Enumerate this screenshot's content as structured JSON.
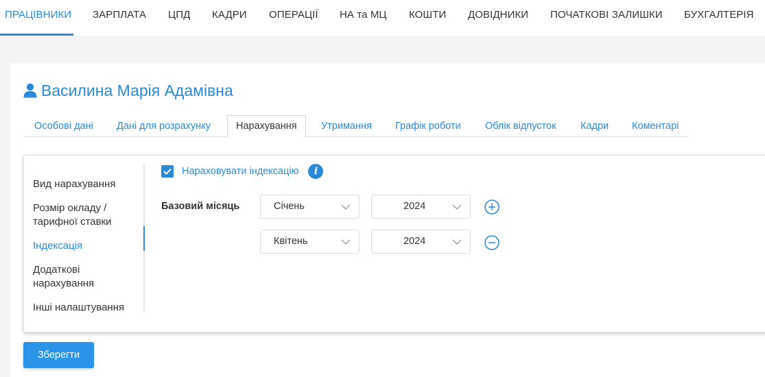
{
  "topnav": {
    "items": [
      "ПРАЦІВНИКИ",
      "ЗАРПЛАТА",
      "ЦПД",
      "КАДРИ",
      "ОПЕРАЦІЇ",
      "НА та МЦ",
      "КОШТИ",
      "ДОВІДНИКИ",
      "ПОЧАТКОВІ ЗАЛИШКИ",
      "БУХГАЛТЕРІЯ"
    ],
    "active_index": 0
  },
  "employee": {
    "icon": "user-icon",
    "name": "Василина Марія Адамівна"
  },
  "tabs": {
    "items": [
      "Особові дані",
      "Дані для розрахунку",
      "Нарахування",
      "Утримання",
      "Графік роботи",
      "Облік відпусток",
      "Кадри",
      "Коментарі"
    ],
    "active_index": 2
  },
  "sidemenu": {
    "items": [
      [
        "Вид нарахування"
      ],
      [
        "Розмір окладу /",
        "тарифної ставки"
      ],
      [
        "Індексація"
      ],
      [
        "Додаткові",
        "нарахування"
      ],
      [
        "Інші налаштування"
      ]
    ],
    "active_index": 2
  },
  "indexation": {
    "checkbox_checked": true,
    "checkbox_label": "Нараховувати індексацію",
    "info_icon": "info-icon",
    "base_month_label": "Базовий місяць",
    "rows": [
      {
        "month": "Січень",
        "year": "2024",
        "action": "add"
      },
      {
        "month": "Квітень",
        "year": "2024",
        "action": "remove"
      }
    ]
  },
  "actions": {
    "save_label": "Зберегти"
  },
  "colors": {
    "accent": "#2a8ad8",
    "button": "#2a95e6"
  }
}
